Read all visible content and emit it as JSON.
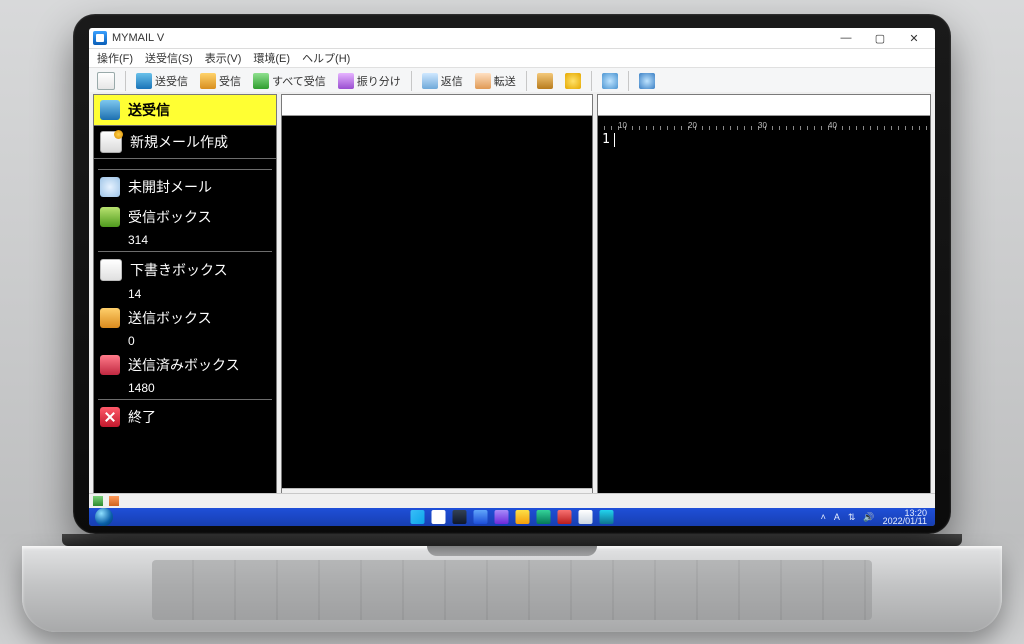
{
  "window": {
    "app_title": "MYMAIL V",
    "controls": {
      "minimize": "—",
      "maximize": "▢",
      "close": "✕"
    }
  },
  "menubar": {
    "items": [
      "操作(F)",
      "送受信(S)",
      "表示(V)",
      "環境(E)",
      "ヘルプ(H)"
    ]
  },
  "toolbar": {
    "compose": "",
    "send_receive": "送受信",
    "receive": "受信",
    "receive_all": "すべて受信",
    "sort": "振り分け",
    "reply": "返信",
    "forward": "転送"
  },
  "sidebar": {
    "send_receive": "送受信",
    "new_mail": "新規メール作成",
    "unread": "未開封メール",
    "inbox": {
      "label": "受信ボックス",
      "count": "314"
    },
    "drafts": {
      "label": "下書きボックス",
      "count": "14"
    },
    "outbox": {
      "label": "送信ボックス",
      "count": "0"
    },
    "sent": {
      "label": "送信済みボックス",
      "count": "1480"
    },
    "exit": "終了"
  },
  "editor": {
    "ruler_marks": [
      "10",
      "20",
      "30",
      "40"
    ],
    "line_number": "1"
  },
  "taskbar": {
    "tray": {
      "ime": "A",
      "time": "13:20",
      "date": "2022/01/11"
    }
  }
}
